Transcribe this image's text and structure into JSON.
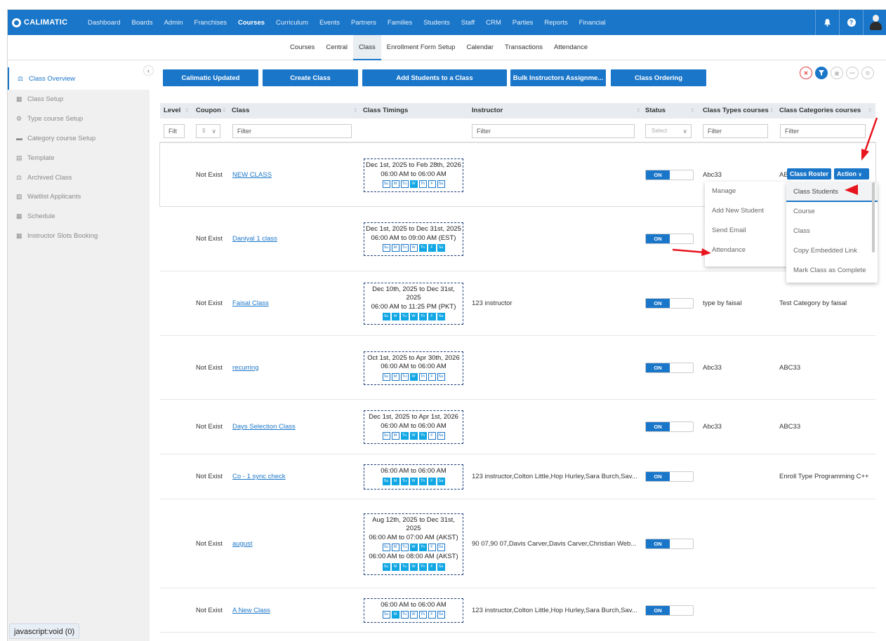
{
  "brand": {
    "name": "CALIMATIC"
  },
  "topnav": {
    "items": [
      "Dashboard",
      "Boards",
      "Admin",
      "Franchises",
      "Courses",
      "Curriculum",
      "Events",
      "Partners",
      "Families",
      "Students",
      "Staff",
      "CRM",
      "Parties",
      "Reports",
      "Financial"
    ],
    "active": "Courses"
  },
  "subnav": {
    "items": [
      "Courses",
      "Central",
      "Class",
      "Enrollment Form Setup",
      "Calendar",
      "Transactions",
      "Attendance"
    ],
    "active": "Class"
  },
  "sidebar": {
    "items": [
      "Class Overview",
      "Class Setup",
      "Type course Setup",
      "Category course Setup",
      "Template",
      "Archived Class",
      "Waitlist Applicants",
      "Schedule",
      "Instructor Slots Booking"
    ]
  },
  "actions": {
    "buttons": [
      "Calimatic Updated",
      "Create Class",
      "Add Students to a Class",
      "Bulk Instructors Assignme...",
      "Class Ordering"
    ]
  },
  "table": {
    "headers": {
      "level": "Level",
      "coupon": "Coupon",
      "class": "Class",
      "timings": "Class Timings",
      "instructor": "Instructor",
      "status": "Status",
      "types": "Class Types courses",
      "categories": "Class Categories courses"
    },
    "filters": {
      "level": "Filt",
      "coupon": "$",
      "class": "Filter",
      "instructor": "Filter",
      "status": "Select",
      "types": "Filter",
      "categories": "Filter"
    },
    "day_labels": [
      "Su",
      "M",
      "Tu",
      "W",
      "Th",
      "F",
      "Sa"
    ],
    "toggle_label": "ON",
    "rows": [
      {
        "coupon": "Not Exist",
        "name": "NEW CLASS",
        "timings": [
          {
            "date": "Dec 1st, 2025 to Feb 28th, 2026",
            "time": "06:00 AM to 06:00 AM",
            "days": [
              0,
              0,
              0,
              1,
              0,
              0,
              0
            ]
          }
        ],
        "instructor": "",
        "status_on": true,
        "types": "Abc33",
        "categories": "AB"
      },
      {
        "coupon": "Not Exist",
        "name": "Daniyal 1 class",
        "timings": [
          {
            "date": "Dec 1st, 2025 to Dec 31st, 2025",
            "time": "06:00 AM to 09:00 AM (EST)",
            "days": [
              0,
              0,
              0,
              0,
              1,
              1,
              1
            ]
          }
        ],
        "instructor": "",
        "status_on": true,
        "types": "",
        "categories": ""
      },
      {
        "coupon": "Not Exist",
        "name": "Faisal Class",
        "timings": [
          {
            "date": "Dec 10th, 2025 to Dec 31st, 2025",
            "time": "06:00 AM to 11:25 PM (PKT)",
            "days": [
              1,
              1,
              1,
              1,
              1,
              1,
              1
            ]
          }
        ],
        "instructor": "123 instructor",
        "status_on": true,
        "types": "type by faisal",
        "categories": "Test Category by faisal"
      },
      {
        "coupon": "Not Exist",
        "name": "recurring",
        "timings": [
          {
            "date": "Oct 1st, 2025 to Apr 30th, 2026",
            "time": "06:00 AM to 06:00 AM",
            "days": [
              0,
              0,
              0,
              1,
              0,
              0,
              0
            ]
          }
        ],
        "instructor": "",
        "status_on": true,
        "types": "Abc33",
        "categories": "ABC33"
      },
      {
        "coupon": "Not Exist",
        "name": "Days Selection Class",
        "timings": [
          {
            "date": "Dec 1st, 2025 to Apr 1st, 2026",
            "time": "06:00 AM to 06:00 AM",
            "days": [
              0,
              0,
              1,
              1,
              1,
              0,
              0
            ]
          }
        ],
        "instructor": "",
        "status_on": true,
        "types": "Abc33",
        "categories": "ABC33"
      },
      {
        "coupon": "Not Exist",
        "name": "Co - 1 sync check",
        "timings": [
          {
            "date": "",
            "time": "06:00 AM to 06:00 AM",
            "days": [
              1,
              1,
              1,
              1,
              1,
              1,
              1
            ]
          }
        ],
        "instructor": "123 instructor,Colton Little,Hop Hurley,Sara Burch,Sav...",
        "status_on": true,
        "types": "",
        "categories": "Enroll Type Programming C++"
      },
      {
        "coupon": "Not Exist",
        "name": "august",
        "timings": [
          {
            "date": "Aug 12th, 2025 to Dec 31st, 2025",
            "time": "06:00 AM to 07:00 AM (AKST)",
            "days": [
              0,
              0,
              0,
              1,
              1,
              0,
              0
            ]
          },
          {
            "date": "",
            "time": "06:00 AM to 08:00 AM (AKST)",
            "days": [
              1,
              1,
              1,
              1,
              1,
              1,
              1
            ]
          }
        ],
        "instructor": "90 07,90 07,Davis Carver,Davis Carver,Christian Web...",
        "status_on": true,
        "types": "",
        "categories": ""
      },
      {
        "coupon": "Not Exist",
        "name": "A New Class",
        "timings": [
          {
            "date": "",
            "time": "06:00 AM to 06:00 AM",
            "days": [
              0,
              1,
              0,
              0,
              0,
              0,
              0
            ]
          }
        ],
        "instructor": "123 instructor,Colton Little,Hop Hurley,Sara Burch,Sav...",
        "status_on": true,
        "types": "",
        "categories": ""
      }
    ]
  },
  "row_actions": {
    "roster": "Class Roster",
    "action": "Action"
  },
  "dropdown_left": [
    "Manage",
    "Add New Student",
    "Send Email",
    "Attendance"
  ],
  "dropdown_right": [
    "Class Students",
    "Course",
    "Class",
    "Copy Embedded Link",
    "Mark Class as Complete"
  ],
  "statusbar": "javascript:void (0)",
  "colors": {
    "primary": "#1a76c9",
    "day_on": "#11a6e4",
    "annotation": "#e8141e"
  }
}
